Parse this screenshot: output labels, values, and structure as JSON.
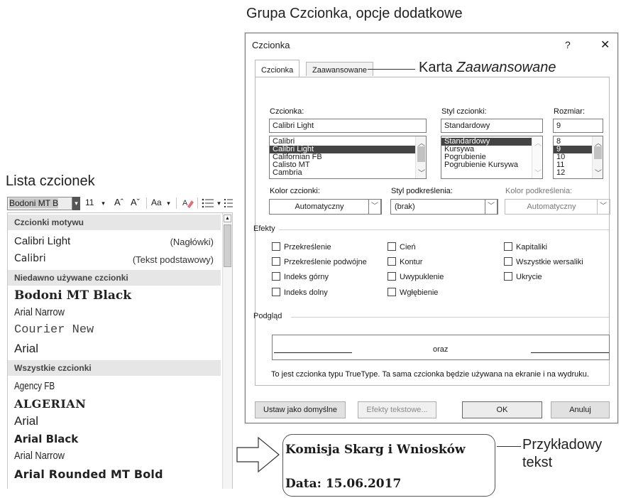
{
  "headings": {
    "group_title": "Grupa Czcionka, opcje dodatkowe",
    "font_list_title": "Lista czcionek",
    "tab_callout_prefix": "Karta ",
    "tab_callout_italic": "Zaawansowane",
    "sample_callout_line1": "Przykładowy",
    "sample_callout_line2": "tekst"
  },
  "toolbar": {
    "font_name": "Bodoni MT B",
    "font_size": "11",
    "grow_glyph": "Aˆ",
    "shrink_glyph": "Aˇ",
    "case_label": "Aa",
    "dropdown_glyph": "▾"
  },
  "font_list": {
    "sections": {
      "theme": "Czcionki motywu",
      "recent": "Niedawno używane czcionki",
      "all": "Wszystkie czcionki"
    },
    "theme_fonts": [
      {
        "name": "Calibri Light",
        "note": "(Nagłówki)"
      },
      {
        "name": "Calibri",
        "note": "(Tekst podstawowy)"
      }
    ],
    "recent_fonts": [
      "Bodoni MT Black",
      "Arial Narrow",
      "Courier New",
      "Arial"
    ],
    "all_fonts": [
      "Agency FB",
      "ALGERIAN",
      "Arial",
      "Arial Black",
      "Arial Narrow",
      "Arial Rounded MT Bold"
    ]
  },
  "dialog": {
    "title": "Czcionka",
    "help": "?",
    "close": "✕",
    "tabs": [
      "Czcionka",
      "Zaawansowane"
    ],
    "font_label": "Czcionka:",
    "font_value": "Calibri Light",
    "font_options": [
      "Calibri",
      "Calibri Light",
      "Californian FB",
      "Calisto MT",
      "Cambria"
    ],
    "font_selected": "Calibri Light",
    "style_label": "Styl czcionki:",
    "style_value": "Standardowy",
    "style_options": [
      "Standardowy",
      "Kursywa",
      "Pogrubienie",
      "Pogrubienie Kursywa"
    ],
    "style_selected": "Standardowy",
    "size_label": "Rozmiar:",
    "size_value": "9",
    "size_options": [
      "8",
      "9",
      "10",
      "11",
      "12"
    ],
    "size_selected": "9",
    "color_label": "Kolor czcionki:",
    "color_value": "Automatyczny",
    "underline_style_label": "Styl podkreślenia:",
    "underline_style_value": "(brak)",
    "underline_color_label": "Kolor podkreślenia:",
    "underline_color_value": "Automatyczny",
    "effects_label": "Efekty",
    "effects": [
      "Przekreślenie",
      "Przekreślenie podwójne",
      "Indeks górny",
      "Indeks dolny",
      "Cień",
      "Kontur",
      "Uwypuklenie",
      "Wgłębienie",
      "Kapitaliki",
      "Wszystkie wersaliki",
      "Ukrycie"
    ],
    "preview_label": "Podgląd",
    "preview_text": "oraz",
    "truetype_note": "To jest czcionka typu TrueType. Ta sama czcionka będzie używana na ekranie i na wydruku.",
    "buttons": {
      "default": "Ustaw jako domyślne",
      "text_effects": "Efekty tekstowe...",
      "ok": "OK",
      "cancel": "Anuluj"
    }
  },
  "sample": {
    "line1": "Komisja Skarg i Wniosków",
    "line2": "Data: 15.06.2017"
  }
}
